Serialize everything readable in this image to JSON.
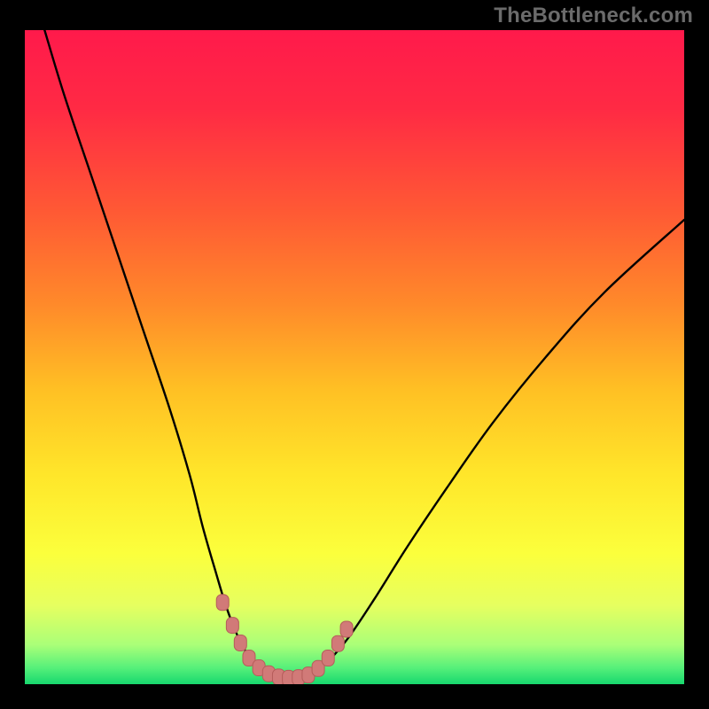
{
  "watermark": "TheBottleneck.com",
  "colors": {
    "bg": "#000000",
    "gradient_stops": [
      {
        "offset": 0.0,
        "color": "#ff1a4b"
      },
      {
        "offset": 0.12,
        "color": "#ff2a44"
      },
      {
        "offset": 0.28,
        "color": "#ff5a34"
      },
      {
        "offset": 0.42,
        "color": "#ff8a2a"
      },
      {
        "offset": 0.55,
        "color": "#ffc024"
      },
      {
        "offset": 0.68,
        "color": "#ffe62a"
      },
      {
        "offset": 0.8,
        "color": "#fbff3c"
      },
      {
        "offset": 0.88,
        "color": "#e6ff60"
      },
      {
        "offset": 0.94,
        "color": "#aaff78"
      },
      {
        "offset": 0.975,
        "color": "#56f07a"
      },
      {
        "offset": 1.0,
        "color": "#17d86e"
      }
    ],
    "curve": "#000000",
    "marker_fill": "#d17a78",
    "marker_stroke": "#b55c5a"
  },
  "chart_data": {
    "type": "line",
    "title": "",
    "xlabel": "",
    "ylabel": "",
    "xlim": [
      0,
      100
    ],
    "ylim": [
      0,
      100
    ],
    "series": [
      {
        "name": "left-curve",
        "x": [
          3,
          6,
          10,
          14,
          18,
          22,
          25,
          27,
          29,
          30.5,
          32,
          33.5,
          35,
          36,
          37
        ],
        "y": [
          100,
          90,
          78,
          66,
          54,
          42,
          32,
          24,
          17,
          12,
          8,
          5,
          3,
          2,
          1.5
        ]
      },
      {
        "name": "valley-floor",
        "x": [
          37,
          38,
          40,
          42,
          43,
          44
        ],
        "y": [
          1.5,
          1.0,
          0.8,
          0.9,
          1.2,
          1.8
        ]
      },
      {
        "name": "right-curve",
        "x": [
          44,
          46,
          49,
          53,
          58,
          64,
          71,
          79,
          88,
          100
        ],
        "y": [
          1.8,
          3.5,
          7,
          13,
          21,
          30,
          40,
          50,
          60,
          71
        ]
      }
    ],
    "markers": {
      "name": "highlight-cluster",
      "points": [
        {
          "x": 30.0,
          "y": 12.5
        },
        {
          "x": 31.5,
          "y": 9.0
        },
        {
          "x": 32.7,
          "y": 6.3
        },
        {
          "x": 34.0,
          "y": 4.0
        },
        {
          "x": 35.5,
          "y": 2.5
        },
        {
          "x": 37.0,
          "y": 1.6
        },
        {
          "x": 38.5,
          "y": 1.1
        },
        {
          "x": 40.0,
          "y": 0.9
        },
        {
          "x": 41.5,
          "y": 1.0
        },
        {
          "x": 43.0,
          "y": 1.4
        },
        {
          "x": 44.5,
          "y": 2.4
        },
        {
          "x": 46.0,
          "y": 4.0
        },
        {
          "x": 47.5,
          "y": 6.2
        },
        {
          "x": 48.8,
          "y": 8.4
        }
      ]
    }
  }
}
